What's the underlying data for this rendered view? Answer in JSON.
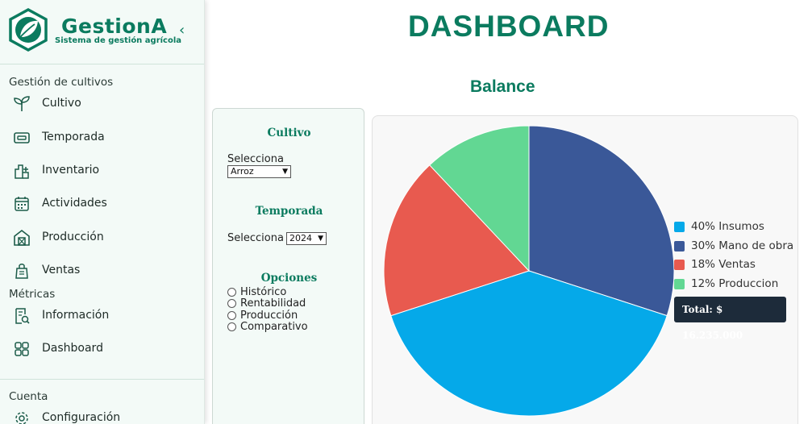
{
  "sidebar": {
    "brand_name": "GestionA",
    "brand_subtitle": "Sistema de gestión agrícola",
    "collapse_glyph": "‹",
    "sections": {
      "crops": "Gestión de cultivos",
      "metrics": "Métricas",
      "account": "Cuenta"
    },
    "items": [
      {
        "label": "Cultivo",
        "icon": "sprout-icon"
      },
      {
        "label": "Temporada",
        "icon": "calendar-card-icon"
      },
      {
        "label": "Inventario",
        "icon": "inventory-icon"
      },
      {
        "label": "Actividades",
        "icon": "calendar-icon"
      },
      {
        "label": "Producción",
        "icon": "barn-icon"
      },
      {
        "label": "Ventas",
        "icon": "bag-icon"
      },
      {
        "label": "Información",
        "icon": "report-search-icon"
      },
      {
        "label": "Dashboard",
        "icon": "dashboard-grid-icon"
      },
      {
        "label": "Configuración",
        "icon": "gear-icon"
      }
    ]
  },
  "header": {
    "title": "DASHBOARD"
  },
  "filters": {
    "cultivo": {
      "heading": "Cultivo",
      "label": "Selecciona",
      "value": "Arroz"
    },
    "temporada": {
      "heading": "Temporada",
      "label": "Selecciona",
      "value": "2024"
    },
    "opciones": {
      "heading": "Opciones",
      "options": [
        "Histórico",
        "Rentabilidad",
        "Producción",
        "Comparativo"
      ]
    }
  },
  "chart_data": {
    "type": "pie",
    "title": "Balance",
    "slices": [
      {
        "label": "40% Insumos",
        "value": 40,
        "color": "#05a9e9"
      },
      {
        "label": "30% Mano de obra",
        "value": 30,
        "color": "#3a5898"
      },
      {
        "label": "18% Ventas",
        "value": 18,
        "color": "#e85a4f"
      },
      {
        "label": "12% Produccion",
        "value": 12,
        "color": "#62d793"
      }
    ],
    "legend_position": "right",
    "tooltip": "Total: $ 16.235.000"
  }
}
